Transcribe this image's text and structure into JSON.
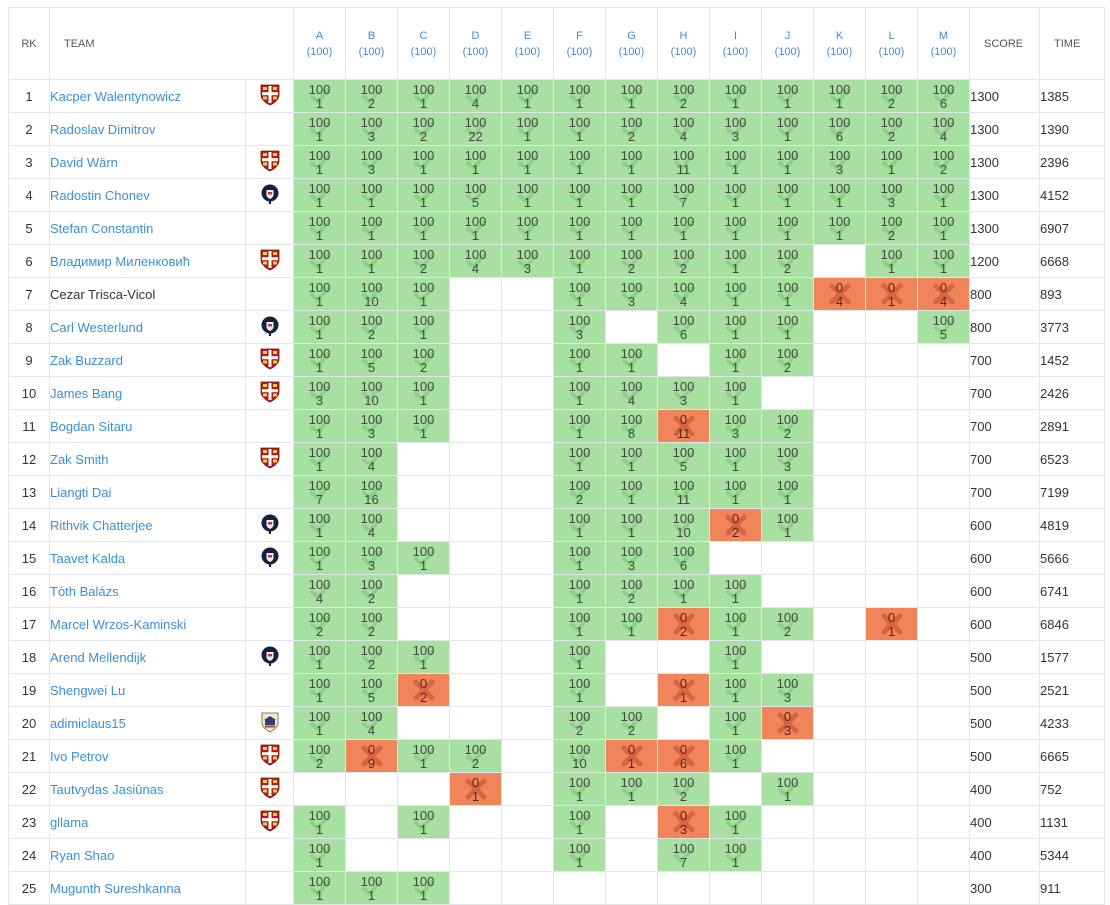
{
  "headers": {
    "rank": "RK",
    "team": "TEAM",
    "score": "SCORE",
    "time": "TIME",
    "problems": [
      {
        "letter": "A",
        "points": "(100)"
      },
      {
        "letter": "B",
        "points": "(100)"
      },
      {
        "letter": "C",
        "points": "(100)"
      },
      {
        "letter": "D",
        "points": "(100)"
      },
      {
        "letter": "E",
        "points": "(100)"
      },
      {
        "letter": "F",
        "points": "(100)"
      },
      {
        "letter": "G",
        "points": "(100)"
      },
      {
        "letter": "H",
        "points": "(100)"
      },
      {
        "letter": "I",
        "points": "(100)"
      },
      {
        "letter": "J",
        "points": "(100)"
      },
      {
        "letter": "K",
        "points": "(100)"
      },
      {
        "letter": "L",
        "points": "(100)"
      },
      {
        "letter": "M",
        "points": "(100)"
      }
    ]
  },
  "colors": {
    "solved": "#a7e0a1",
    "failed": "#f0845a",
    "link": "#3a8fd6"
  },
  "rows": [
    {
      "rank": "1",
      "team": "Kacper Walentynowicz",
      "link": true,
      "logo": "cambridge-crest-icon",
      "score": "1300",
      "time": "1385",
      "cells": [
        "100/1",
        "100/2",
        "100/1",
        "100/4",
        "100/1",
        "100/1",
        "100/1",
        "100/2",
        "100/1",
        "100/1",
        "100/1",
        "100/2",
        "100/6"
      ]
    },
    {
      "rank": "2",
      "team": "Radoslav Dimitrov",
      "link": true,
      "logo": "",
      "score": "1300",
      "time": "1390",
      "cells": [
        "100/1",
        "100/3",
        "100/2",
        "100/22",
        "100/1",
        "100/1",
        "100/2",
        "100/4",
        "100/3",
        "100/1",
        "100/6",
        "100/2",
        "100/4"
      ]
    },
    {
      "rank": "3",
      "team": "David Wärn",
      "link": true,
      "logo": "cambridge-crest-icon",
      "score": "1300",
      "time": "2396",
      "cells": [
        "100/1",
        "100/3",
        "100/1",
        "100/1",
        "100/1",
        "100/1",
        "100/1",
        "100/11",
        "100/1",
        "100/1",
        "100/3",
        "100/1",
        "100/2"
      ]
    },
    {
      "rank": "4",
      "team": "Radostin Chonev",
      "link": true,
      "logo": "oxford-crest-icon",
      "score": "1300",
      "time": "4152",
      "cells": [
        "100/1",
        "100/1",
        "100/1",
        "100/5",
        "100/1",
        "100/1",
        "100/1",
        "100/7",
        "100/1",
        "100/1",
        "100/1",
        "100/3",
        "100/1"
      ]
    },
    {
      "rank": "5",
      "team": "Stefan Constantin",
      "link": true,
      "logo": "",
      "score": "1300",
      "time": "6907",
      "cells": [
        "100/1",
        "100/1",
        "100/1",
        "100/1",
        "100/1",
        "100/1",
        "100/1",
        "100/1",
        "100/1",
        "100/1",
        "100/1",
        "100/2",
        "100/1"
      ]
    },
    {
      "rank": "6",
      "team": "Владимир Миленковић",
      "link": true,
      "logo": "cambridge-crest-icon",
      "score": "1200",
      "time": "6668",
      "cells": [
        "100/1",
        "100/1",
        "100/2",
        "100/4",
        "100/3",
        "100/1",
        "100/2",
        "100/2",
        "100/1",
        "100/2",
        "",
        "100/1",
        "100/1"
      ]
    },
    {
      "rank": "7",
      "team": "Cezar Trisca-Vicol",
      "link": false,
      "logo": "",
      "score": "800",
      "time": "893",
      "cells": [
        "100/1",
        "100/10",
        "100/1",
        "",
        "",
        "100/1",
        "100/3",
        "100/4",
        "100/1",
        "100/1",
        "0/4",
        "0/1",
        "0/4"
      ]
    },
    {
      "rank": "8",
      "team": "Carl Westerlund",
      "link": true,
      "logo": "oxford-crest-icon",
      "score": "800",
      "time": "3773",
      "cells": [
        "100/1",
        "100/2",
        "100/1",
        "",
        "",
        "100/3",
        "",
        "100/6",
        "100/1",
        "100/1",
        "",
        "",
        "100/5"
      ]
    },
    {
      "rank": "9",
      "team": "Zak Buzzard",
      "link": true,
      "logo": "cambridge-crest-icon",
      "score": "700",
      "time": "1452",
      "cells": [
        "100/1",
        "100/5",
        "100/2",
        "",
        "",
        "100/1",
        "100/1",
        "",
        "100/1",
        "100/2",
        "",
        "",
        ""
      ]
    },
    {
      "rank": "10",
      "team": "James Bang",
      "link": true,
      "logo": "cambridge-crest-icon",
      "score": "700",
      "time": "2426",
      "cells": [
        "100/3",
        "100/10",
        "100/1",
        "",
        "",
        "100/1",
        "100/4",
        "100/3",
        "100/1",
        "",
        "",
        "",
        ""
      ]
    },
    {
      "rank": "11",
      "team": "Bogdan Sitaru",
      "link": true,
      "logo": "",
      "score": "700",
      "time": "2891",
      "cells": [
        "100/1",
        "100/3",
        "100/1",
        "",
        "",
        "100/1",
        "100/8",
        "0/11",
        "100/3",
        "100/2",
        "",
        "",
        ""
      ]
    },
    {
      "rank": "12",
      "team": "Zak Smith",
      "link": true,
      "logo": "cambridge-crest-icon",
      "score": "700",
      "time": "6523",
      "cells": [
        "100/1",
        "100/4",
        "",
        "",
        "",
        "100/1",
        "100/1",
        "100/5",
        "100/1",
        "100/3",
        "",
        "",
        ""
      ]
    },
    {
      "rank": "13",
      "team": "Liangti Dai",
      "link": true,
      "logo": "",
      "score": "700",
      "time": "7199",
      "cells": [
        "100/7",
        "100/16",
        "",
        "",
        "",
        "100/2",
        "100/1",
        "100/11",
        "100/1",
        "100/1",
        "",
        "",
        ""
      ]
    },
    {
      "rank": "14",
      "team": "Rithvik Chatterjee",
      "link": true,
      "logo": "oxford-crest-icon",
      "score": "600",
      "time": "4819",
      "cells": [
        "100/1",
        "100/4",
        "",
        "",
        "",
        "100/1",
        "100/1",
        "100/10",
        "0/2",
        "100/1",
        "",
        "",
        ""
      ]
    },
    {
      "rank": "15",
      "team": "Taavet Kalda",
      "link": true,
      "logo": "oxford-crest-icon",
      "score": "600",
      "time": "5666",
      "cells": [
        "100/1",
        "100/3",
        "100/1",
        "",
        "",
        "100/1",
        "100/3",
        "100/6",
        "",
        "",
        "",
        "",
        ""
      ]
    },
    {
      "rank": "16",
      "team": "Tóth Balázs",
      "link": true,
      "logo": "",
      "score": "600",
      "time": "6741",
      "cells": [
        "100/4",
        "100/2",
        "",
        "",
        "",
        "100/1",
        "100/2",
        "100/1",
        "100/1",
        "",
        "",
        "",
        ""
      ]
    },
    {
      "rank": "17",
      "team": "Marcel Wrzos-Kaminski",
      "link": true,
      "logo": "",
      "score": "600",
      "time": "6846",
      "cells": [
        "100/2",
        "100/2",
        "",
        "",
        "",
        "100/1",
        "100/1",
        "0/2",
        "100/1",
        "100/2",
        "",
        "0/1",
        ""
      ]
    },
    {
      "rank": "18",
      "team": "Arend Mellendijk",
      "link": true,
      "logo": "oxford-crest-icon",
      "score": "500",
      "time": "1577",
      "cells": [
        "100/1",
        "100/2",
        "100/1",
        "",
        "",
        "100/1",
        "",
        "",
        "100/1",
        "",
        "",
        "",
        ""
      ]
    },
    {
      "rank": "19",
      "team": "Shengwei Lu",
      "link": true,
      "logo": "",
      "score": "500",
      "time": "2521",
      "cells": [
        "100/1",
        "100/5",
        "0/2",
        "",
        "",
        "100/1",
        "",
        "0/1",
        "100/1",
        "100/3",
        "",
        "",
        ""
      ]
    },
    {
      "rank": "20",
      "team": "adimiclaus15",
      "link": true,
      "logo": "bucharest-crest-icon",
      "score": "500",
      "time": "4233",
      "cells": [
        "100/1",
        "100/4",
        "",
        "",
        "",
        "100/2",
        "100/2",
        "",
        "100/1",
        "0/3",
        "",
        "",
        ""
      ]
    },
    {
      "rank": "21",
      "team": "Ivo Petrov",
      "link": true,
      "logo": "cambridge-crest-icon",
      "score": "500",
      "time": "6665",
      "cells": [
        "100/2",
        "0/9",
        "100/1",
        "100/2",
        "",
        "100/10",
        "0/1",
        "0/6",
        "100/1",
        "",
        "",
        "",
        ""
      ]
    },
    {
      "rank": "22",
      "team": "Tautvydas Jasiūnas",
      "link": true,
      "logo": "cambridge-crest-icon",
      "score": "400",
      "time": "752",
      "cells": [
        "",
        "",
        "",
        "0/1",
        "",
        "100/1",
        "100/1",
        "100/2",
        "",
        "100/1",
        "",
        "",
        ""
      ]
    },
    {
      "rank": "23",
      "team": "gllama",
      "link": true,
      "logo": "cambridge-crest-icon",
      "score": "400",
      "time": "1131",
      "cells": [
        "100/1",
        "",
        "100/1",
        "",
        "",
        "100/1",
        "",
        "0/3",
        "100/1",
        "",
        "",
        "",
        ""
      ]
    },
    {
      "rank": "24",
      "team": "Ryan Shao",
      "link": true,
      "logo": "",
      "score": "400",
      "time": "5344",
      "cells": [
        "100/1",
        "",
        "",
        "",
        "",
        "100/1",
        "",
        "100/7",
        "100/1",
        "",
        "",
        "",
        ""
      ]
    },
    {
      "rank": "25",
      "team": "Mugunth Sureshkanna",
      "link": true,
      "logo": "",
      "score": "300",
      "time": "911",
      "cells": [
        "100/1",
        "100/1",
        "100/1",
        "",
        "",
        "",
        "",
        "",
        "",
        "",
        "",
        "",
        ""
      ]
    }
  ]
}
